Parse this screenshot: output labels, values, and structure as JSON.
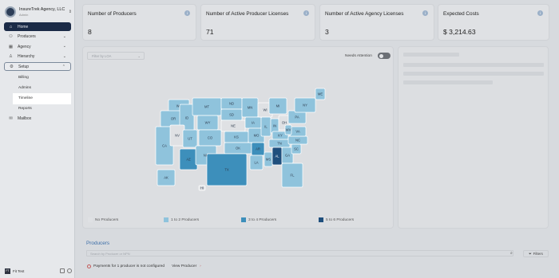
{
  "org": {
    "name": "InsureTrek Agency, LLC",
    "sub": "Admin"
  },
  "nav": {
    "home": "Home",
    "producers": "Producers",
    "agency": "Agency",
    "hierarchy": "Hierarchy",
    "setup": "Setup",
    "setup_items": [
      "Billing",
      "Admins",
      "Timeline",
      "Reports"
    ],
    "mailbox": "Mailbox"
  },
  "footer": {
    "initials": "FT",
    "user": "Fit Test"
  },
  "cards": [
    {
      "label": "Number of Producers",
      "value": "8"
    },
    {
      "label": "Number of Active Producer Licenses",
      "value": "71"
    },
    {
      "label": "Number of Active Agency Licenses",
      "value": "3"
    },
    {
      "label": "Expected Costs",
      "value": "$ 3,214.63"
    }
  ],
  "map": {
    "filter_placeholder": "Filter by LOA",
    "needs_attention": "Needs Attention",
    "needs_attention_on": false,
    "legend": [
      {
        "label": "No Producers",
        "color": "#dfe1e4"
      },
      {
        "label": "1 to 2 Producers",
        "color": "#8fc3dc"
      },
      {
        "label": "3 to 4 Producers",
        "color": "#3d8fbb"
      },
      {
        "label": "5 to 6 Producers",
        "color": "#1f4f7d"
      }
    ],
    "states": [
      {
        "code": "WA",
        "tier": 1
      },
      {
        "code": "OR",
        "tier": 1
      },
      {
        "code": "CA",
        "tier": 1
      },
      {
        "code": "ID",
        "tier": 1
      },
      {
        "code": "NV",
        "tier": 0
      },
      {
        "code": "UT",
        "tier": 1
      },
      {
        "code": "AZ",
        "tier": 2
      },
      {
        "code": "MT",
        "tier": 1
      },
      {
        "code": "WY",
        "tier": 1
      },
      {
        "code": "CO",
        "tier": 1
      },
      {
        "code": "NM",
        "tier": 1
      },
      {
        "code": "ND",
        "tier": 1
      },
      {
        "code": "SD",
        "tier": 1
      },
      {
        "code": "NE",
        "tier": 0
      },
      {
        "code": "KS",
        "tier": 1
      },
      {
        "code": "OK",
        "tier": 1
      },
      {
        "code": "TX",
        "tier": 2
      },
      {
        "code": "MN",
        "tier": 1
      },
      {
        "code": "IA",
        "tier": 1
      },
      {
        "code": "MO",
        "tier": 1
      },
      {
        "code": "AR",
        "tier": 2
      },
      {
        "code": "LA",
        "tier": 1
      },
      {
        "code": "WI",
        "tier": 0
      },
      {
        "code": "IL",
        "tier": 1
      },
      {
        "code": "MS",
        "tier": 1
      },
      {
        "code": "MI",
        "tier": 1
      },
      {
        "code": "IN",
        "tier": 1
      },
      {
        "code": "KY",
        "tier": 1
      },
      {
        "code": "TN",
        "tier": 1
      },
      {
        "code": "AL",
        "tier": 3
      },
      {
        "code": "OH",
        "tier": 0
      },
      {
        "code": "GA",
        "tier": 1
      },
      {
        "code": "FL",
        "tier": 1
      },
      {
        "code": "SC",
        "tier": 1
      },
      {
        "code": "NC",
        "tier": 1
      },
      {
        "code": "VA",
        "tier": 1
      },
      {
        "code": "WV",
        "tier": 1
      },
      {
        "code": "PA",
        "tier": 1
      },
      {
        "code": "NY",
        "tier": 1
      },
      {
        "code": "ME",
        "tier": 1
      },
      {
        "code": "AK",
        "tier": 1
      },
      {
        "code": "HI",
        "tier": 0
      }
    ]
  },
  "producers": {
    "title": "Producers",
    "search_placeholder": "Search by Producer or NPN",
    "filters_label": "Filters",
    "warning": "Payments for 1 producer is not configured",
    "view_label": "View Producer"
  }
}
